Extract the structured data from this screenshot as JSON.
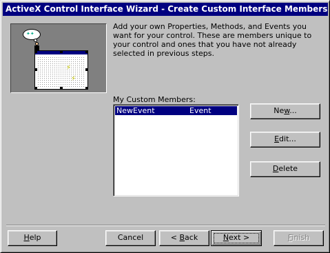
{
  "window": {
    "title": "ActiveX Control Interface Wizard - Create Custom Interface Members"
  },
  "intro_text": "Add your own Properties, Methods, and Events you want for your control.  These are members unique to your control and ones that you have not already selected in previous steps.",
  "members": {
    "label": "My Custom Members:",
    "items": [
      {
        "name": "NewEvent",
        "type": "Event",
        "selected": true
      }
    ]
  },
  "side_buttons": {
    "new": {
      "pre": "Ne",
      "mnemonic": "w",
      "post": "..."
    },
    "edit": {
      "pre": "",
      "mnemonic": "E",
      "post": "dit..."
    },
    "delete": {
      "pre": "",
      "mnemonic": "D",
      "post": "elete"
    }
  },
  "footer": {
    "help": {
      "pre": "",
      "mnemonic": "H",
      "post": "elp"
    },
    "cancel": "Cancel",
    "back": {
      "pre": "< ",
      "mnemonic": "B",
      "post": "ack"
    },
    "next": {
      "pre": "",
      "mnemonic": "N",
      "post": "ext >"
    },
    "finish": {
      "pre": "",
      "mnemonic": "F",
      "post": "inish",
      "enabled": false
    }
  },
  "colors": {
    "title_bar": "#000080",
    "face": "#c0c0c0",
    "selection": "#000080"
  }
}
